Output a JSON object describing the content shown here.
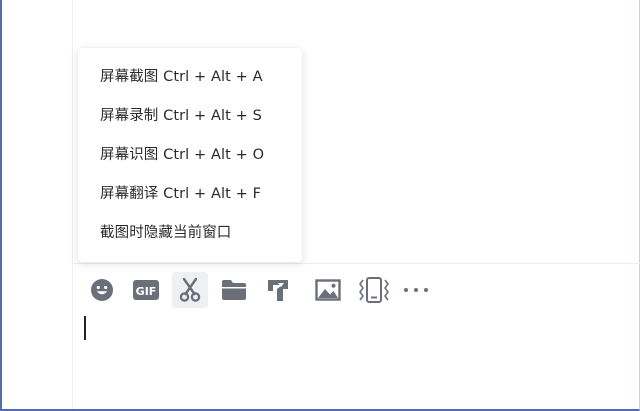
{
  "menu": {
    "items": [
      {
        "label": "屏幕截图 Ctrl + Alt + A"
      },
      {
        "label": "屏幕录制 Ctrl + Alt + S"
      },
      {
        "label": "屏幕识图 Ctrl + Alt + O"
      },
      {
        "label": "屏幕翻译 Ctrl + Alt + F"
      },
      {
        "label": "截图时隐藏当前窗口"
      }
    ]
  },
  "toolbar": {
    "gif_label": "GIF",
    "icons": [
      "emoji-icon",
      "gif-icon",
      "scissors-icon",
      "folder-icon",
      "screen-share-icon",
      "image-icon",
      "shake-icon",
      "more-icon"
    ]
  },
  "colors": {
    "icon": "#6b6f7a",
    "frame_accent": "#4f6fa3"
  }
}
